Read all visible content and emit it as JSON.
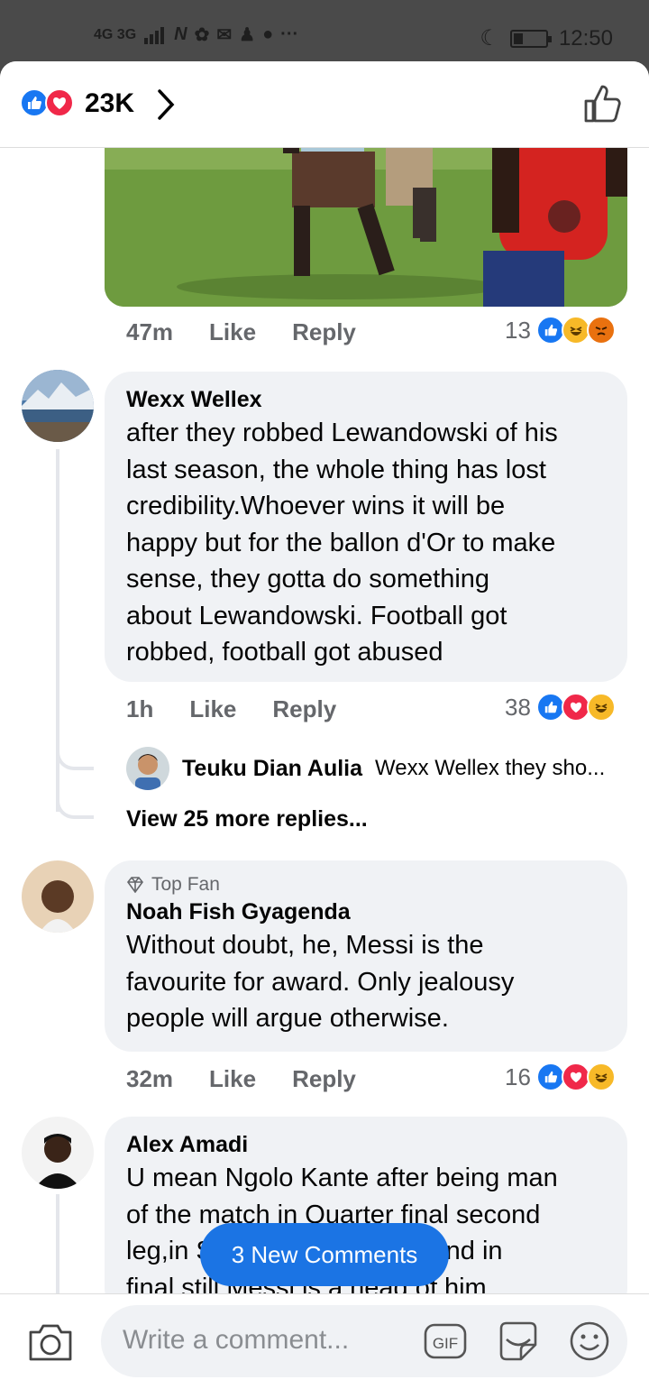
{
  "status_bar": {
    "network": "4G 3G",
    "time": "12:50"
  },
  "header": {
    "reaction_count": "23K"
  },
  "comments": [
    {
      "time": "47m",
      "like": "Like",
      "reply": "Reply",
      "reaction_count": "13"
    },
    {
      "name": "Wexx Wellex",
      "text_lines": [
        "after they robbed Lewandowski of his",
        "last season, the whole thing has lost",
        "credibility.Whoever wins it will be",
        "happy but for the ballon d'Or to make",
        "sense, they gotta do something",
        "about Lewandowski. Football got",
        "robbed, football got abused"
      ],
      "time": "1h",
      "like": "Like",
      "reply": "Reply",
      "reaction_count": "38",
      "reply_preview": {
        "name": "Teuku Dian Aulia",
        "text": "Wexx Wellex they sho..."
      },
      "view_more": "View 25 more replies..."
    },
    {
      "badge": "Top Fan",
      "name": "Noah Fish Gyagenda",
      "text_lines": [
        "Without doubt, he, Messi is the",
        "favourite for  award. Only jealousy",
        "people will argue otherwise."
      ],
      "time": "32m",
      "like": "Like",
      "reply": "Reply",
      "reaction_count": "16"
    },
    {
      "name": "Alex Amadi",
      "text_lines": [
        "U mean Ngolo Kante after being man",
        "of the match in Quarter final second",
        "leg,in Semi final both legs and in",
        "final still Messi is a head of him"
      ]
    }
  ],
  "new_comments_pill": "3 New Comments",
  "composer": {
    "placeholder": "Write a comment...",
    "gif_label": "GIF"
  },
  "colors": {
    "like_blue": "#1877f2",
    "love_red": "#f02849",
    "haha_yellow": "#f7b928",
    "angry_orange": "#e9710f",
    "pill_blue": "#1b74e4"
  }
}
